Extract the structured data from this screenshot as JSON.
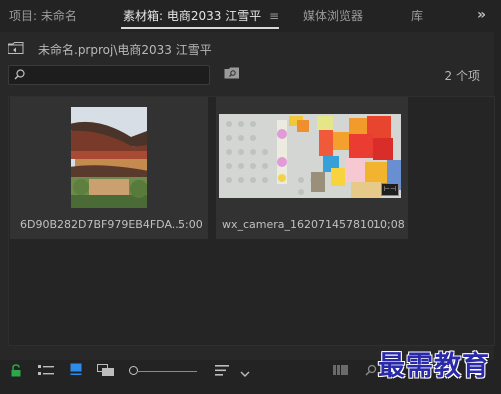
{
  "tabs": [
    {
      "label": "项目: 未命名",
      "active": false
    },
    {
      "label": "素材箱: 电商2033 江雪平",
      "active": true
    },
    {
      "label": "媒体浏览器",
      "active": false
    },
    {
      "label": "库",
      "active": false
    }
  ],
  "tab_menu_glyph": "≡",
  "tab_overflow_glyph": "»",
  "path": "未命名.prproj\\电商2033 江雪平",
  "search": {
    "placeholder": "",
    "value": ""
  },
  "item_count": "2 个项",
  "items": [
    {
      "name": "6D90B282D7BF979EB4FDA...",
      "duration": "5:00",
      "thumbnail": "pagoda-photo"
    },
    {
      "name": "wx_camera_162071457810...",
      "duration": "10;08",
      "thumbnail": "lego-video",
      "badge": "video-clip-icon"
    }
  ],
  "watermark": "最需教育",
  "colors": {
    "background": "#232323",
    "panel": "#282828",
    "card": "#323232",
    "lock_icon": "#2aa84a",
    "icon_view_active": "#2d8ceb",
    "watermark": "#2a2aa8"
  }
}
